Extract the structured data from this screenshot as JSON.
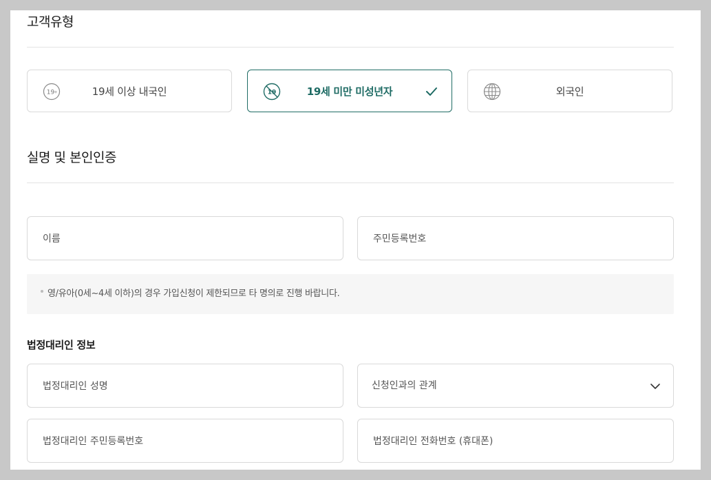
{
  "customer_type": {
    "title": "고객유형",
    "options": [
      {
        "label": "19세 이상 내국인",
        "icon": "adult-19plus-icon",
        "selected": false
      },
      {
        "label": "19세 미만 미성년자",
        "icon": "minor-under19-icon",
        "selected": true
      },
      {
        "label": "외국인",
        "icon": "globe-icon",
        "selected": false
      }
    ]
  },
  "verification": {
    "title": "실명 및 본인인증",
    "name_placeholder": "이름",
    "rrn_placeholder": "주민등록번호",
    "notice": "영/유아(0세~4세 이하)의 경우 가입신청이 제한되므로 타 명의로 진행 바랍니다."
  },
  "guardian": {
    "title": "법정대리인 정보",
    "name_placeholder": "법정대리인 성명",
    "relation_label": "신청인과의 관계",
    "rrn_placeholder": "법정대리인 주민등록번호",
    "phone_placeholder": "법정대리인 전화번호 (휴대폰)"
  },
  "colors": {
    "accent": "#1e6b64",
    "border": "#d9d9d9",
    "notice_bg": "#f6f6f6"
  }
}
